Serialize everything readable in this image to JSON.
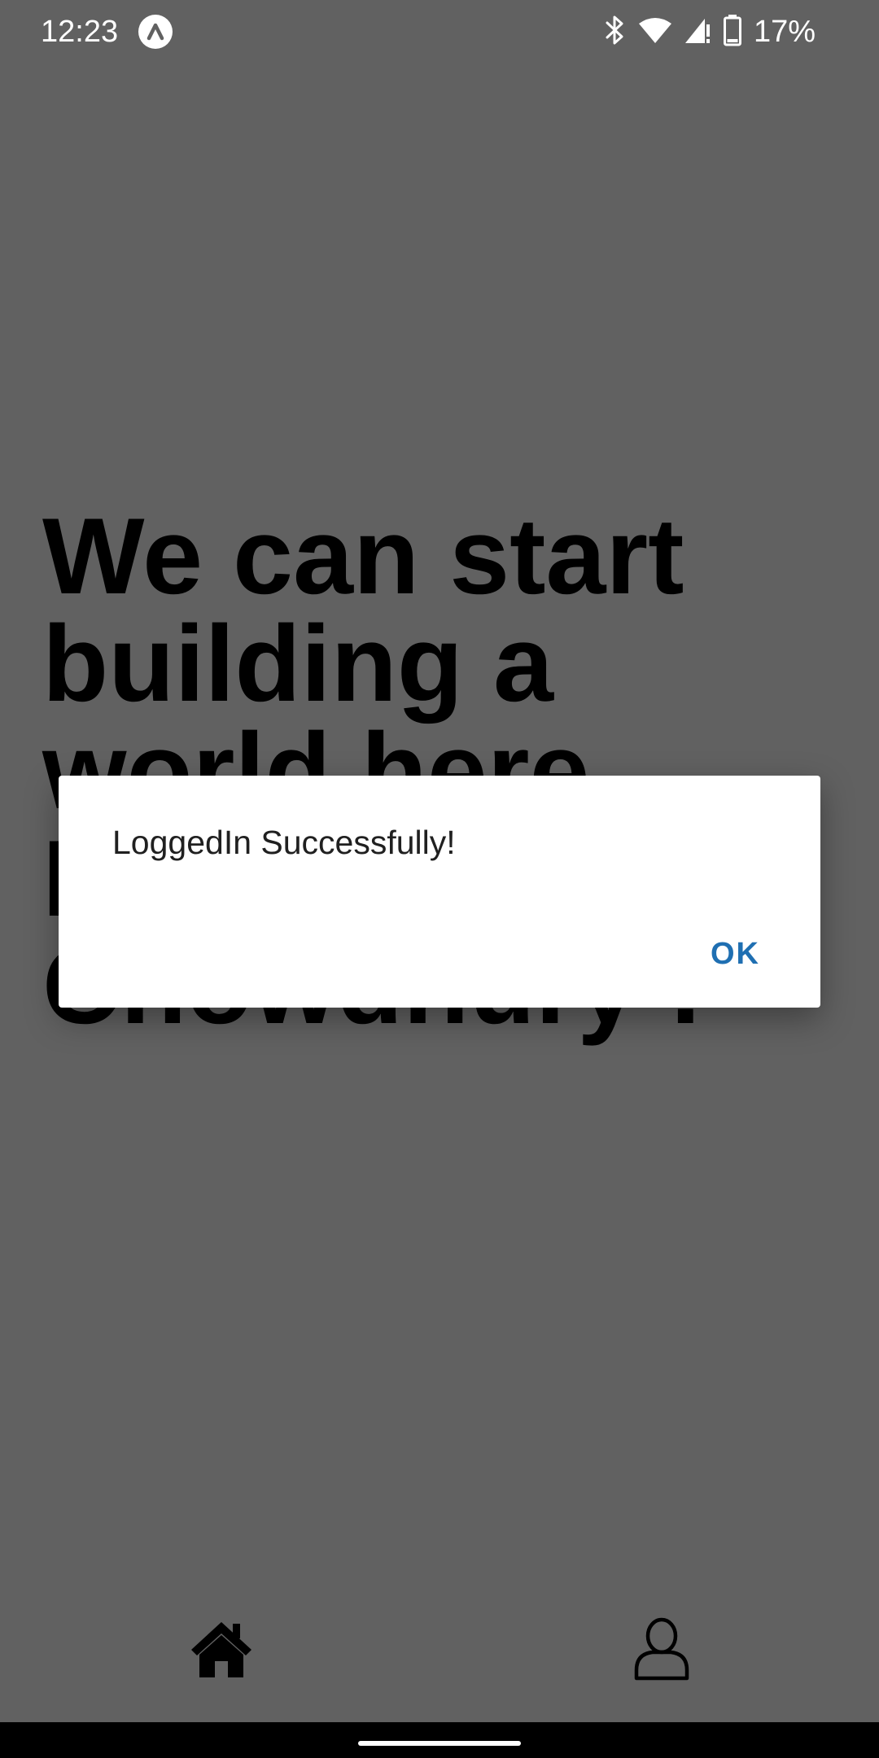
{
  "status_bar": {
    "time": "12:23",
    "battery_percent": "17%",
    "icons": [
      "app-notification-icon",
      "bluetooth-icon",
      "wifi-icon",
      "cell-signal-icon",
      "battery-icon"
    ]
  },
  "main": {
    "heading": "We can start building a world here Nuren Sultan Chowdhury !"
  },
  "dialog": {
    "message": "LoggedIn Successfully!",
    "ok_label": "OK"
  },
  "bottom_nav": {
    "items": [
      {
        "icon": "home-icon"
      },
      {
        "icon": "profile-icon"
      }
    ]
  },
  "colors": {
    "scrim_background": "#616161",
    "dialog_background": "#ffffff",
    "accent": "#1f6fb2"
  }
}
